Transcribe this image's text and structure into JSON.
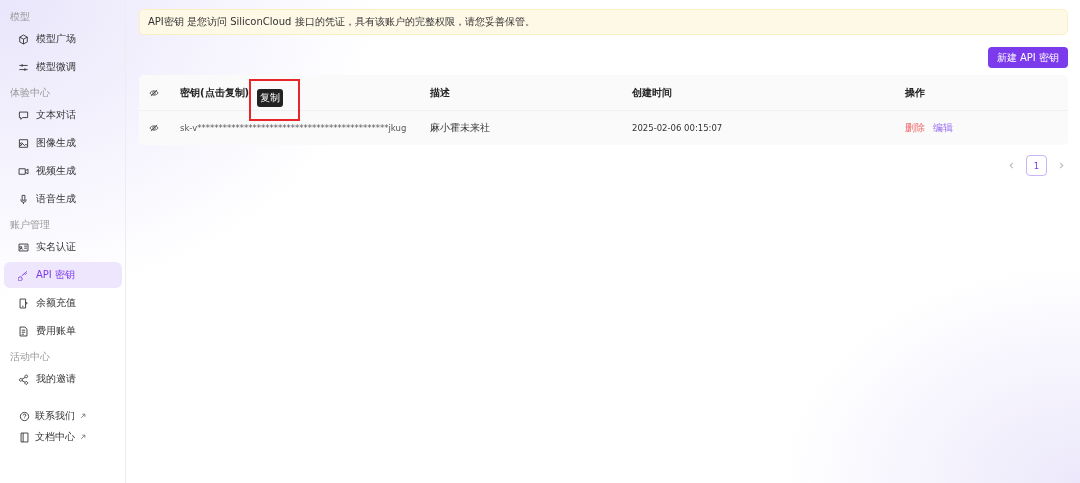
{
  "sidebar": {
    "sections": [
      {
        "label": "模型",
        "items": [
          {
            "label": "模型广场",
            "selected": false
          },
          {
            "label": "模型微调",
            "selected": false
          }
        ]
      },
      {
        "label": "体验中心",
        "items": [
          {
            "label": "文本对话",
            "selected": false
          },
          {
            "label": "图像生成",
            "selected": false
          },
          {
            "label": "视频生成",
            "selected": false
          },
          {
            "label": "语音生成",
            "selected": false
          }
        ]
      },
      {
        "label": "账户管理",
        "items": [
          {
            "label": "实名认证",
            "selected": false
          },
          {
            "label": "API 密钥",
            "selected": true
          },
          {
            "label": "余额充值",
            "selected": false
          },
          {
            "label": "费用账单",
            "selected": false
          }
        ]
      },
      {
        "label": "活动中心",
        "items": [
          {
            "label": "我的邀请",
            "selected": false
          }
        ]
      }
    ],
    "links": [
      {
        "label": "联系我们"
      },
      {
        "label": "文档中心"
      }
    ]
  },
  "notice": "API密钥 是您访问 SiliconCloud 接口的凭证，具有该账户的完整权限，请您妥善保管。",
  "new_button": "新建 API 密钥",
  "table": {
    "columns": [
      "密钥(点击复制)",
      "描述",
      "创建时间",
      "操作"
    ],
    "rows": [
      {
        "key": "sk-v*********************************************jkug",
        "description": "麻小霍未来社",
        "created": "2025-02-06 00:15:07",
        "actions": [
          {
            "label": "删除",
            "kind": "danger"
          },
          {
            "label": "编辑",
            "kind": "primary"
          }
        ]
      }
    ]
  },
  "tooltip": "复制",
  "pagination": {
    "pages": [
      {
        "label": "1",
        "selected": true
      }
    ]
  }
}
